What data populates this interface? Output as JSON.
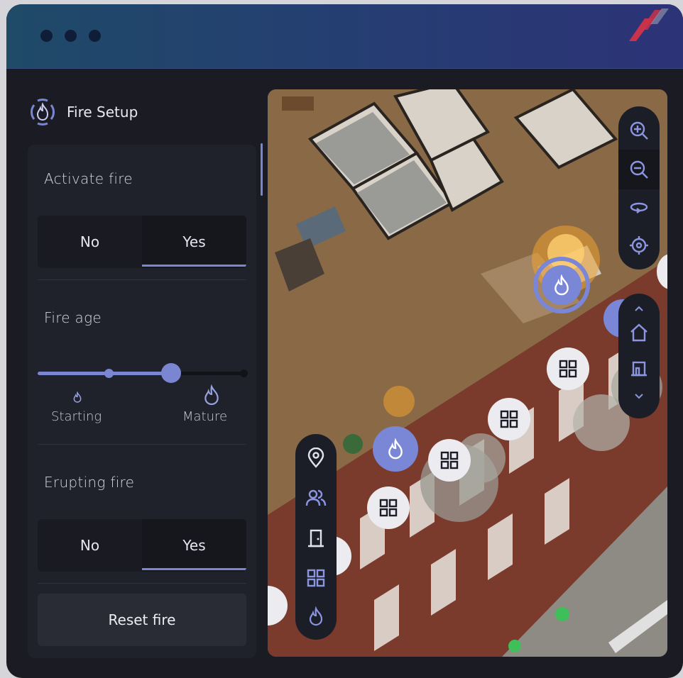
{
  "window": {
    "title_bar_dots": 3,
    "brand_logo": "stripes-logo-icon",
    "colors": {
      "accent": "#7b86d3",
      "panel_bg": "#20222b",
      "window_bg": "#1b1c23"
    }
  },
  "fire_setup": {
    "title": "Fire Setup",
    "icon": "fire-target-icon",
    "activate_fire": {
      "label": "Activate fire",
      "options": [
        "No",
        "Yes"
      ],
      "selected": "Yes"
    },
    "fire_age": {
      "label": "Fire age",
      "min_label": "Starting",
      "max_label": "Mature",
      "value_fraction": 0.64,
      "steps": 3
    },
    "erupting_fire": {
      "label": "Erupting fire",
      "options": [
        "No",
        "Yes"
      ],
      "selected": "Yes"
    },
    "reset_label": "Reset fire"
  },
  "map_controls": {
    "zoom": [
      "zoom-in-icon",
      "zoom-out-icon",
      "rotate-icon",
      "recenter-icon"
    ],
    "floors": [
      "chevron-up-icon",
      "house-icon",
      "floor-icon",
      "chevron-down-icon"
    ],
    "layers": [
      "location-pin-icon",
      "people-icon",
      "door-icon",
      "window-grid-icon",
      "fire-icon"
    ]
  }
}
